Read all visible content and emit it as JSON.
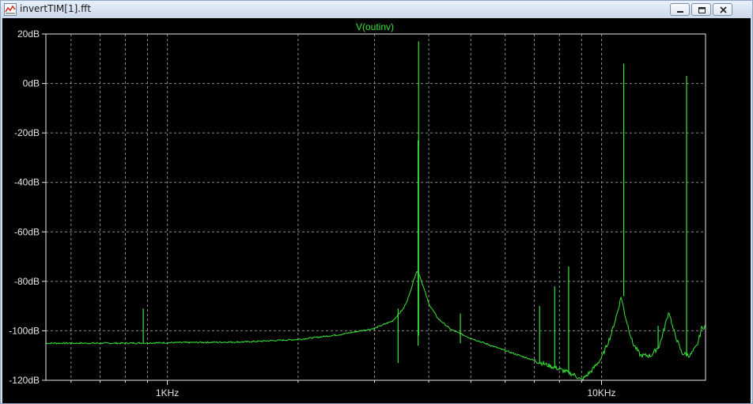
{
  "window": {
    "title": "invertTIM[1].fft",
    "icon": "waveform-icon",
    "controls": [
      "minimize-icon",
      "restore-icon",
      "close-icon"
    ]
  },
  "colors": {
    "trace": "#39e639",
    "axis": "#e6e6e6",
    "grid": "#8a8a8a",
    "background": "#000000"
  },
  "chart_data": {
    "type": "line",
    "title": "V(outinv)",
    "x_scale": "log",
    "y_scale": "linear",
    "x_unit": "Hz",
    "xlim": [
      525,
      17360
    ],
    "ylim": [
      -120,
      20
    ],
    "y_ticks": [
      20,
      0,
      -20,
      -40,
      -60,
      -80,
      -100,
      -120
    ],
    "y_tick_labels": [
      "20dB",
      "0dB",
      "-20dB",
      "-40dB",
      "-60dB",
      "-80dB",
      "-100dB",
      "-120dB"
    ],
    "x_ticks": [
      1000,
      10000
    ],
    "x_tick_labels": [
      "1KHz",
      "10KHz"
    ],
    "x_minor_ticks": [
      600,
      700,
      800,
      900,
      2000,
      3000,
      4000,
      5000,
      6000,
      7000,
      8000,
      9000
    ],
    "grid": true,
    "series": [
      {
        "name": "V(outinv)",
        "floor": [
          [
            525,
            -105
          ],
          [
            800,
            -105
          ],
          [
            1000,
            -104.8
          ],
          [
            1500,
            -104.5
          ],
          [
            2000,
            -103.5
          ],
          [
            2500,
            -101.5
          ],
          [
            3000,
            -99
          ],
          [
            3300,
            -96
          ],
          [
            3500,
            -91
          ],
          [
            3600,
            -86
          ],
          [
            3700,
            -79
          ],
          [
            3750,
            -76
          ],
          [
            3800,
            -77
          ],
          [
            3900,
            -83
          ],
          [
            4000,
            -89
          ],
          [
            4200,
            -95
          ],
          [
            4500,
            -99.5
          ],
          [
            5000,
            -103
          ],
          [
            6000,
            -108
          ],
          [
            7000,
            -112
          ],
          [
            8000,
            -115.5
          ],
          [
            8700,
            -118
          ],
          [
            9000,
            -120
          ],
          [
            9500,
            -116
          ],
          [
            10000,
            -111
          ],
          [
            10500,
            -102
          ],
          [
            10900,
            -92
          ],
          [
            11100,
            -86
          ],
          [
            11300,
            -93
          ],
          [
            11800,
            -105
          ],
          [
            12300,
            -110
          ],
          [
            13000,
            -110
          ],
          [
            13600,
            -106
          ],
          [
            14000,
            -98
          ],
          [
            14300,
            -92
          ],
          [
            14600,
            -99
          ],
          [
            15300,
            -109
          ],
          [
            16000,
            -110
          ],
          [
            16600,
            -106
          ],
          [
            17000,
            -99
          ],
          [
            17360,
            -98
          ]
        ],
        "spikes": [
          {
            "x": 880,
            "top": -91,
            "base": -105
          },
          {
            "x": 3400,
            "top": -91,
            "base": -113
          },
          {
            "x": 3780,
            "top": -23,
            "base": -106
          },
          {
            "x": 3790,
            "top": 17,
            "base": -102
          },
          {
            "x": 4730,
            "top": -93,
            "base": -105
          },
          {
            "x": 7200,
            "top": -90,
            "base": -113
          },
          {
            "x": 7800,
            "top": -82,
            "base": -115
          },
          {
            "x": 8400,
            "top": -74,
            "base": -117
          },
          {
            "x": 11250,
            "top": 8,
            "base": -86
          },
          {
            "x": 13500,
            "top": -98,
            "base": -107
          },
          {
            "x": 15700,
            "top": 3,
            "base": -110
          }
        ]
      }
    ]
  }
}
